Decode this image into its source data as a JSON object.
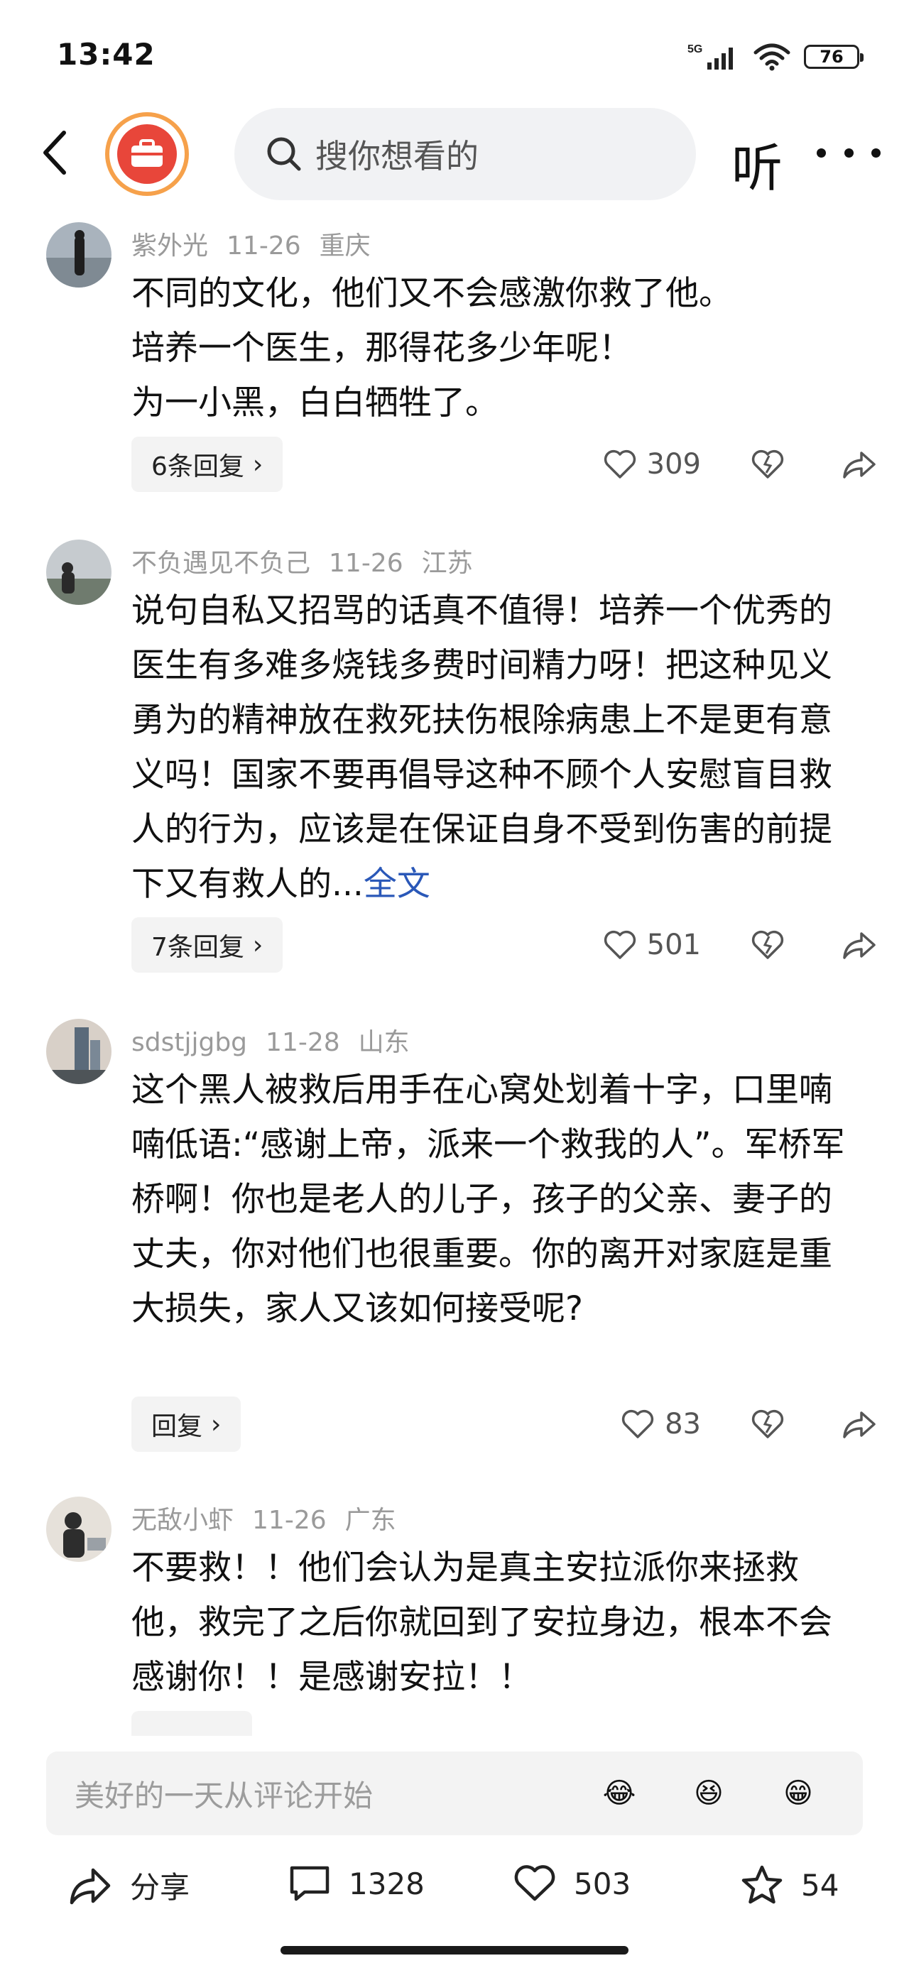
{
  "status": {
    "time": "13:42",
    "network": "5G",
    "battery": "76"
  },
  "header": {
    "search_placeholder": "搜你想看的",
    "listen_label": "听"
  },
  "comments": [
    {
      "user": "紫外光",
      "date": "11-26",
      "location": "重庆",
      "lines": [
        "不同的文化，他们又不会感激你救了他。",
        "培养一个医生，那得花多少年呢！",
        "为一小黑，白白牺牲了。"
      ],
      "reply_label": "6条回复",
      "likes": "309"
    },
    {
      "user": "不负遇见不负己",
      "date": "11-26",
      "location": "江苏",
      "text": "说句自私又招骂的话真不值得！培养一个优秀的医生有多难多烧钱多费时间精力呀！把这种见义勇为的精神放在救死扶伤根除病患上不是更有意义吗！国家不要再倡导这种不顾个人安慰盲目救人的行为，应该是在保证自身不受到伤害的前提下又有救人的...",
      "more_label": "全文",
      "reply_label": "7条回复",
      "likes": "501"
    },
    {
      "user": "sdstjjgbg",
      "date": "11-28",
      "location": "山东",
      "text": "这个黑人被救后用手在心窝处划着十字，口里喃喃低语:“感谢上帝，派来一个救我的人”。军桥军桥啊！你也是老人的儿子，孩子的父亲、妻子的丈夫，你对他们也很重要。你的离开对家庭是重大损失，家人又该如何接受呢?",
      "reply_label": "回复",
      "likes": "83"
    },
    {
      "user": "无敌小虾",
      "date": "11-26",
      "location": "广东",
      "text": "不要救！！他们会认为是真主安拉派你来拯救他，救完了之后你就回到了安拉身边，根本不会感谢你！！是感谢安拉！！"
    }
  ],
  "comment_bar": {
    "placeholder": "美好的一天从评论开始",
    "emojis": [
      "😂",
      "😆",
      "😁"
    ]
  },
  "bottom_bar": {
    "share_label": "分享",
    "comment_count": "1328",
    "like_count": "503",
    "favorite_count": "54"
  }
}
